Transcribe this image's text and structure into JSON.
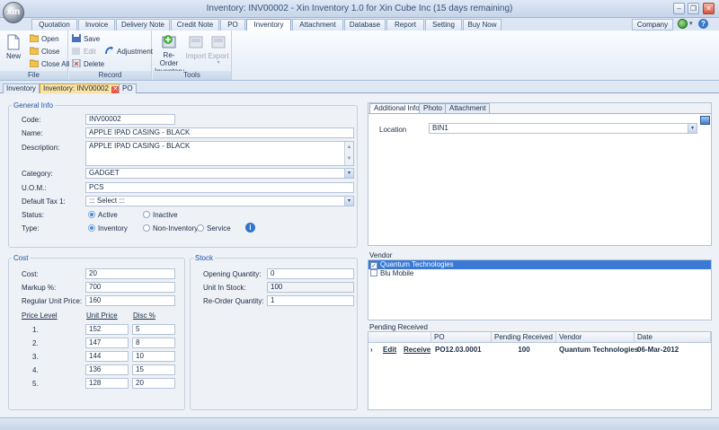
{
  "window": {
    "title": "Inventory: INV00002 - Xin Inventory 1.0 for Xin Cube Inc (15 days remaining)",
    "logo_text": "xin"
  },
  "menu": {
    "tabs": [
      "Quotation",
      "Invoice",
      "Delivery Note",
      "Credit Note",
      "PO",
      "Inventory",
      "Attachment",
      "Database",
      "Report",
      "Setting",
      "Buy Now"
    ],
    "active": "Inventory",
    "company_label": "Company"
  },
  "ribbon": {
    "file": {
      "label": "File",
      "new": "New",
      "open": "Open",
      "close": "Close",
      "close_all": "Close All"
    },
    "record": {
      "label": "Record",
      "save": "Save",
      "edit": "Edit",
      "delete": "Delete",
      "adjustment": "Adjustment"
    },
    "tools": {
      "label": "Tools",
      "reorder_line1": "Re-Order",
      "reorder_line2": "Inventory",
      "import": "Import",
      "export": "Export"
    }
  },
  "doc_tabs": [
    {
      "label": "Inventory",
      "active": false
    },
    {
      "label": "Inventory: INV00002",
      "active": true
    },
    {
      "label": "PO",
      "active": false
    }
  ],
  "general": {
    "legend": "General Info",
    "code_label": "Code:",
    "code": "INV00002",
    "name_label": "Name:",
    "name": "APPLE IPAD CASING - BLACK",
    "desc_label": "Description:",
    "description": "APPLE IPAD CASING - BLACK",
    "category_label": "Category:",
    "category": "GADGET",
    "uom_label": "U.O.M.:",
    "uom": "PCS",
    "tax_label": "Default Tax 1:",
    "tax": "::: Select :::",
    "status_label": "Status:",
    "status_active": "Active",
    "status_inactive": "Inactive",
    "type_label": "Type:",
    "type_inventory": "Inventory",
    "type_non_inventory": "Non-Inventory",
    "type_service": "Service"
  },
  "cost": {
    "legend": "Cost",
    "cost_label": "Cost:",
    "cost": "20",
    "markup_label": "Markup %:",
    "markup": "700",
    "regular_label": "Regular Unit Price:",
    "regular": "160",
    "hdr_level": "Price Level",
    "hdr_price": "Unit Price",
    "hdr_disc": "Disc %",
    "levels": [
      {
        "level": "1.",
        "price": "152",
        "disc": "5"
      },
      {
        "level": "2.",
        "price": "147",
        "disc": "8"
      },
      {
        "level": "3.",
        "price": "144",
        "disc": "10"
      },
      {
        "level": "4.",
        "price": "136",
        "disc": "15"
      },
      {
        "level": "5.",
        "price": "128",
        "disc": "20"
      }
    ]
  },
  "stock": {
    "legend": "Stock",
    "opening_label": "Opening Quantity:",
    "opening": "0",
    "instock_label": "Unit In Stock:",
    "instock": "100",
    "reorder_label": "Re-Order Quantity:",
    "reorder": "1"
  },
  "additional": {
    "tabs": [
      "Additional Info",
      "Photo",
      "Attachment"
    ],
    "location_label": "Location",
    "location": "BIN1"
  },
  "vendor": {
    "label": "Vendor",
    "items": [
      {
        "name": "Quantum Technologies",
        "checked": true
      },
      {
        "name": "Blu Mobile",
        "checked": false
      }
    ]
  },
  "pending": {
    "label": "Pending Received",
    "headers": [
      "PO",
      "Pending Received",
      "Vendor",
      "Date"
    ],
    "rows": [
      {
        "edit": "Edit",
        "receive": "Receive",
        "po": "PO12.03.0001",
        "qty": "100",
        "vendor": "Quantum Technologies",
        "date": "06-Mar-2012"
      }
    ]
  }
}
